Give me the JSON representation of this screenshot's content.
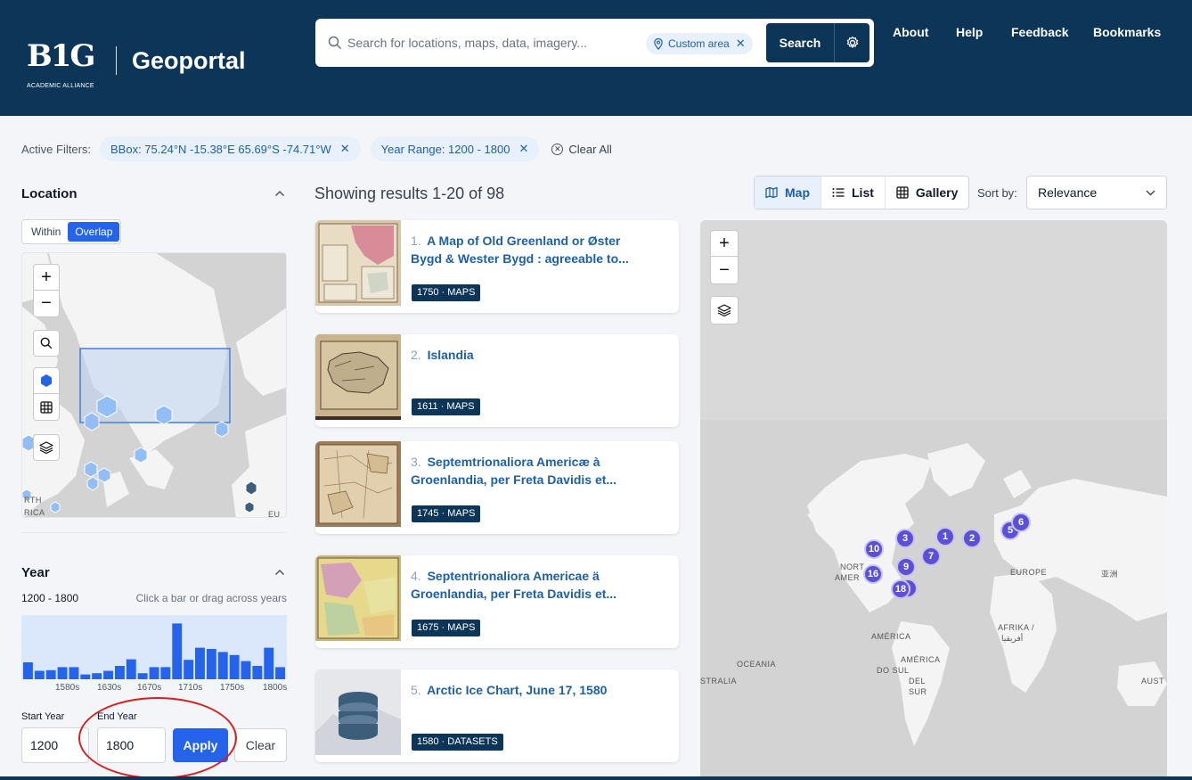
{
  "header": {
    "logo_text": "B1G",
    "logo_sub": "ACADEMIC ALLIANCE",
    "app_title": "Geoportal",
    "search_placeholder": "Search for locations, maps, data, imagery...",
    "area_chip": "Custom area",
    "search_button": "Search",
    "nav": [
      "About",
      "Help",
      "Feedback",
      "Bookmarks"
    ]
  },
  "filters": {
    "label": "Active Filters:",
    "chips": [
      "BBox: 75.24°N -15.38°E 65.69°S -74.71°W",
      "Year Range: 1200 - 1800"
    ],
    "clear_all": "Clear All"
  },
  "sidebar": {
    "location_title": "Location",
    "mode_options": [
      "Within",
      "Overlap"
    ],
    "mode_selected": "Overlap",
    "minimap_labels": [
      "RTH",
      "RICA",
      "EU"
    ],
    "year_title": "Year",
    "year_range": "1200 - 1800",
    "year_hint": "Click a bar or drag across years",
    "histogram": {
      "bars": [
        0.28,
        0.14,
        0.15,
        0.2,
        0.2,
        0.08,
        0.1,
        0.14,
        0.22,
        0.33,
        0.1,
        0.2,
        0.2,
        0.92,
        0.32,
        0.52,
        0.5,
        0.45,
        0.4,
        0.3,
        0.22,
        0.52,
        0.2
      ],
      "ticks": [
        "1580s",
        "1630s",
        "1670s",
        "1710s",
        "1750s",
        "1800s"
      ]
    },
    "start_label": "Start Year",
    "start_value": "1200",
    "end_label": "End Year",
    "end_value": "1800",
    "apply": "Apply",
    "clear": "Clear"
  },
  "results": {
    "count_text": "Showing results 1-20 of 98",
    "views": [
      "Map",
      "List",
      "Gallery"
    ],
    "active_view": "Map",
    "sort_label": "Sort by:",
    "sort_value": "Relevance",
    "items": [
      {
        "num": "1.",
        "title": "A Map of Old Greenland or Øster Bygd & Wester Bygd : agreeable to...",
        "badge": "1750 · MAPS"
      },
      {
        "num": "2.",
        "title": "Islandia",
        "badge": "1611 · MAPS"
      },
      {
        "num": "3.",
        "title": "Septemtrionaliora Americæ à Groenlandia, per Freta Davidis et...",
        "badge": "1745 · MAPS"
      },
      {
        "num": "4.",
        "title": "Septentrionaliora Americae ä Groenlandia, per Freta Davidis et...",
        "badge": "1675 · MAPS"
      },
      {
        "num": "5.",
        "title": "Arctic Ice Chart, June 17, 1580",
        "badge": "1580 · DATASETS"
      }
    ]
  },
  "bigmap": {
    "clusters": [
      "1",
      "2",
      "3",
      "5",
      "6",
      "7",
      "9",
      "10",
      "16",
      "18",
      "9"
    ],
    "labels": [
      "EUROPE",
      "NORT",
      "AMER",
      "AMÉRICA",
      "AMÉRICA",
      "DO SUL",
      "DEL",
      "SUR",
      "OCEANIA",
      "AFRIKA /",
      "أفريقيا",
      "STRALIA",
      "AUST",
      "亚洲"
    ]
  },
  "colors": {
    "navy": "#0c3557",
    "accent": "#2563eb",
    "cluster": "#5b50d6",
    "annotation": "#d42020"
  }
}
